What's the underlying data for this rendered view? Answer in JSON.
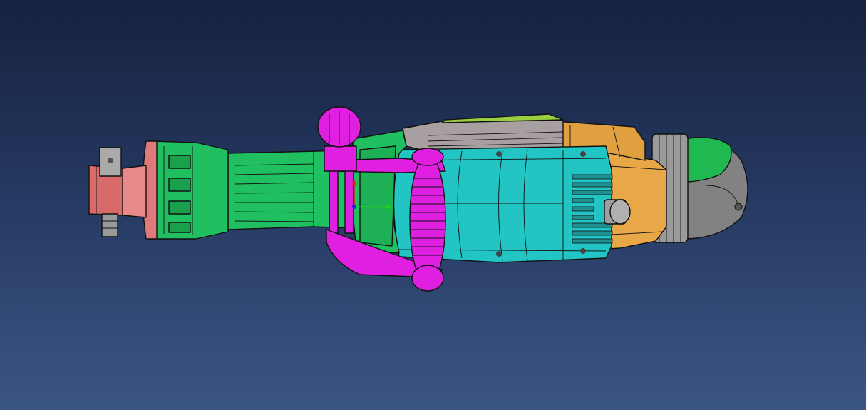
{
  "viewer": {
    "background_top": "#16213f",
    "background_bottom": "#3b5583"
  },
  "model": {
    "part_colors": {
      "chuck": "#e07a7a",
      "gear_housing": "#20c060",
      "motor_housing": "#22c4c4",
      "side_handle": "#e020e0",
      "rear_housing": "#e8a848",
      "top_cover": "#9aa0a0",
      "end_cap": "#808080"
    }
  },
  "triad": {
    "x_axis_color": "#22cc22",
    "y_axis_color": "#dd2222",
    "z_axis_color": "#2222dd"
  }
}
